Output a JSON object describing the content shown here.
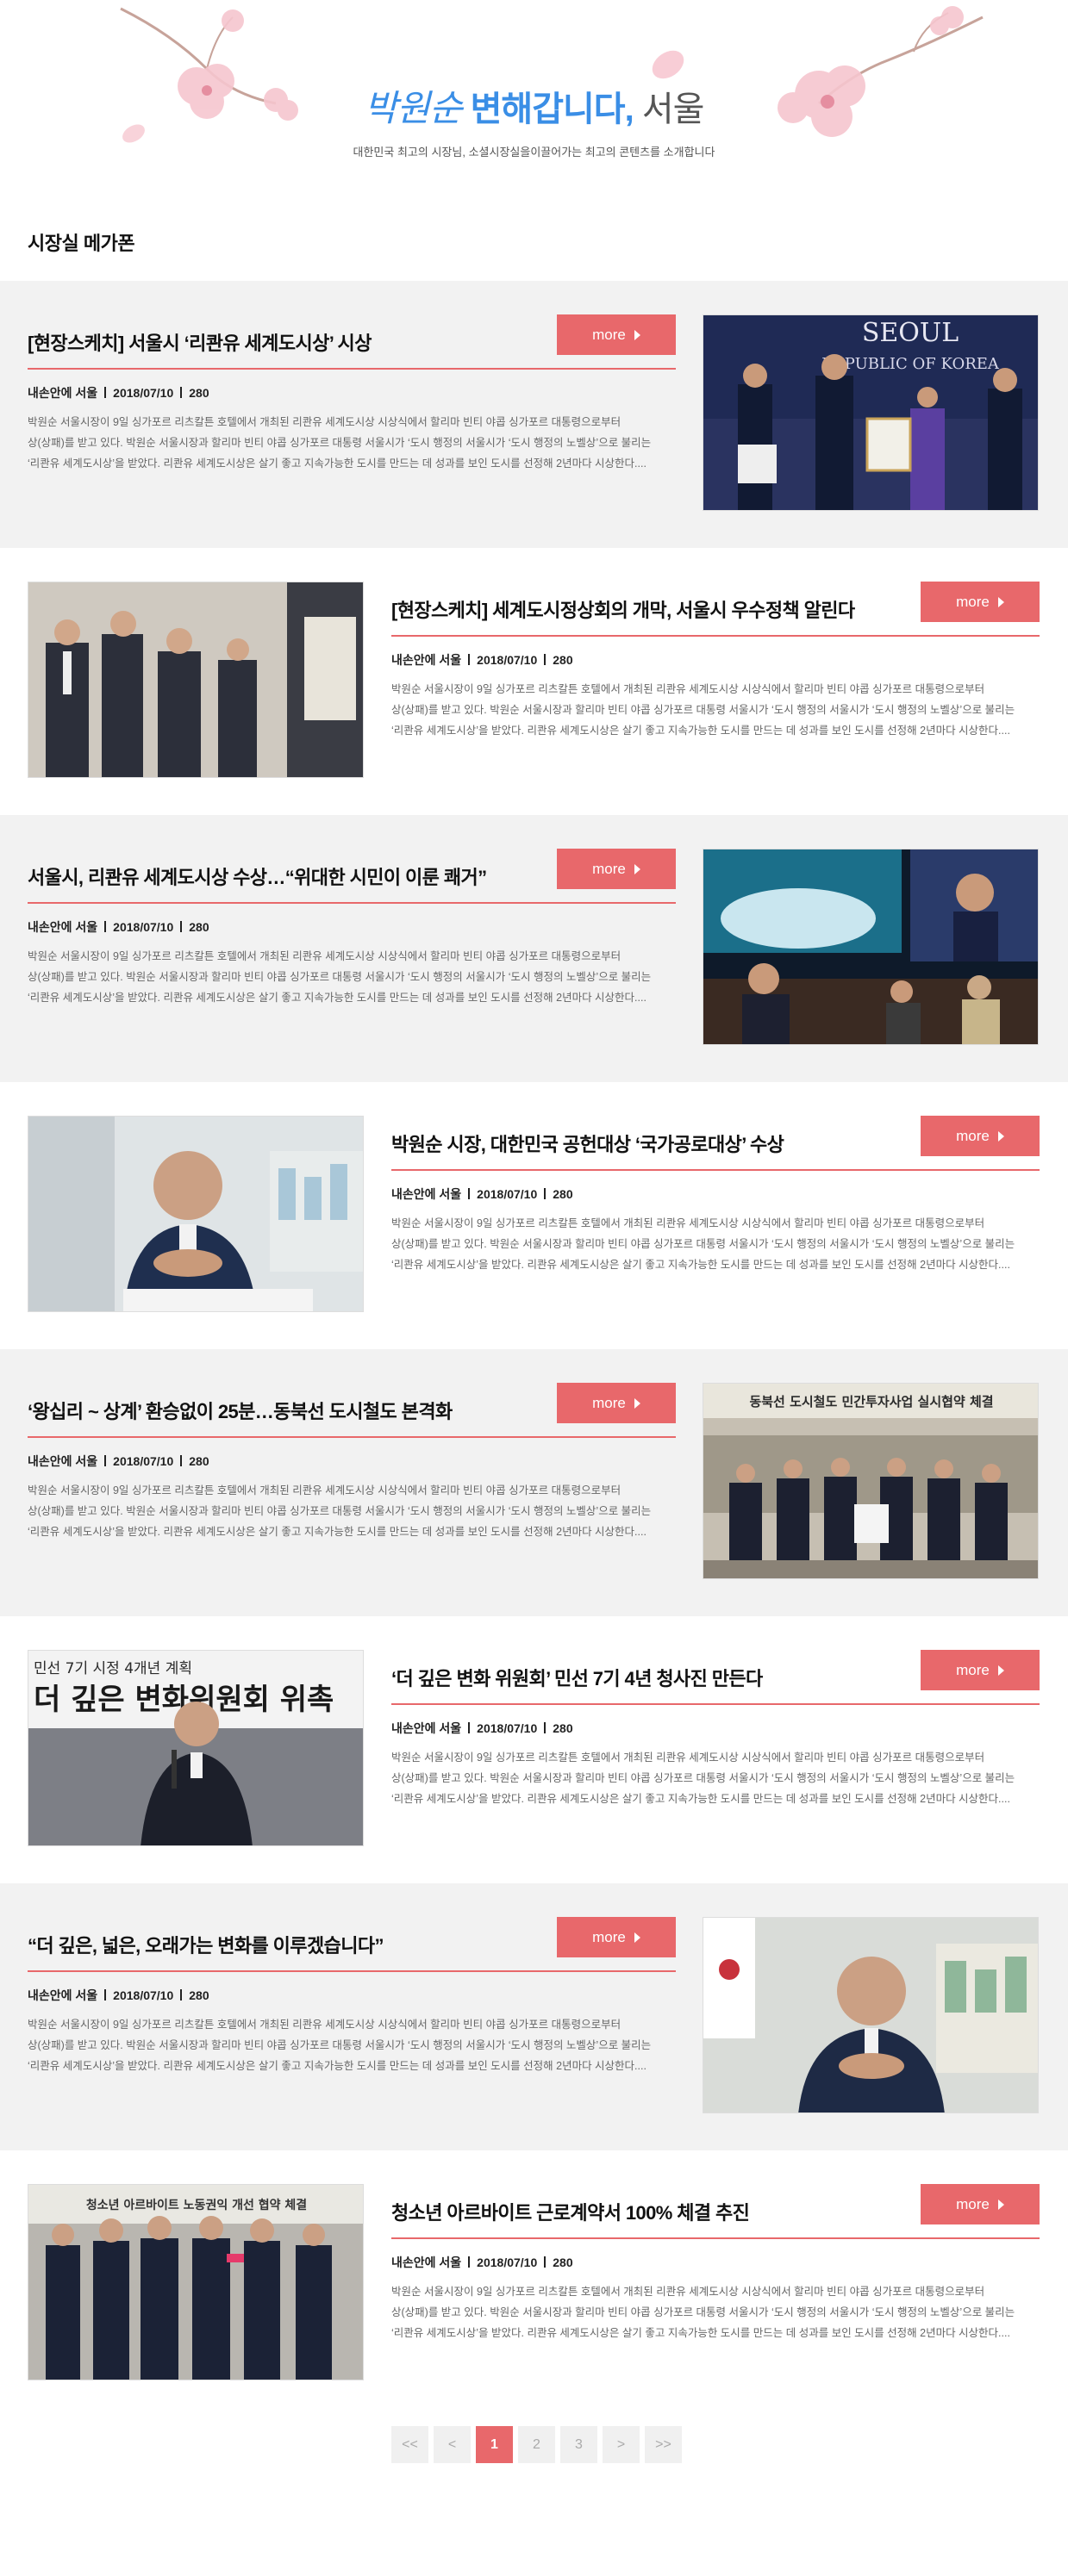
{
  "hero": {
    "title_name": "박원순",
    "title_main": "변해갑니다,",
    "title_city": "서울",
    "subtitle": "대한민국 최고의 시장님, 소셜시장실을이끌어가는 최고의 콘텐츠를 소개합니다"
  },
  "section": {
    "title": "시장실 메가폰"
  },
  "colors": {
    "accent": "#e8686b",
    "title_blue": "#3a8ee6",
    "row_gray": "#f2f2f2"
  },
  "articles": [
    {
      "title": "[현장스케치] 서울시 ‘리콴유 세계도시상’ 시상",
      "author": "내손안에 서울",
      "date": "2018/07/10",
      "views": "280",
      "more": "more",
      "body1": "박원순 서울시장이 9일 싱가포르 리츠칼튼 호텔에서 개최된 리콴유 세계도시상 시상식에서 할리마 빈티 야콥 싱가포르 대통령으로부터",
      "body2": "상(상패)를 받고 있다. 박원순 서울시장과 할리마 빈티 야콥 싱가포르 대통령 서울시가 ‘도시 행정의 서울시가 ‘도시 행정의 노벨상’으로 불리는",
      "body3": "‘리콴유 세계도시상’을 받았다. 리콴유 세계도시상은 살기 좋고 지속가능한 도시를 만드는 데 성과를 보인 도시를 선정해 2년마다 시상한다....",
      "image": "award-ceremony-photo",
      "photo_text": "SEOUL",
      "photo_text2": "REPUBLIC OF KOREA"
    },
    {
      "title": "[현장스케치] 세계도시정상회의 개막, 서울시 우수정책 알린다",
      "author": "내손안에 서울",
      "date": "2018/07/10",
      "views": "280",
      "more": "more",
      "body1": "박원순 서울시장이 9일 싱가포르 리츠칼튼 호텔에서 개최된 리콴유 세계도시상 시상식에서 할리마 빈티 야콥 싱가포르 대통령으로부터",
      "body2": "상(상패)를 받고 있다. 박원순 서울시장과 할리마 빈티 야콥 싱가포르 대통령 서울시가 ‘도시 행정의 서울시가 ‘도시 행정의 노벨상’으로 불리는",
      "body3": "‘리콴유 세계도시상’을 받았다. 리콴유 세계도시상은 살기 좋고 지속가능한 도시를 만드는 데 성과를 보인 도시를 선정해 2년마다 시상한다....",
      "image": "exhibition-visit-photo"
    },
    {
      "title": "서울시, 리콴유 세계도시상 수상…“위대한 시민이 이룬 쾌거”",
      "author": "내손안에 서울",
      "date": "2018/07/10",
      "views": "280",
      "more": "more",
      "body1": "박원순 서울시장이 9일 싱가포르 리츠칼튼 호텔에서 개최된 리콴유 세계도시상 시상식에서 할리마 빈티 야콥 싱가포르 대통령으로부터",
      "body2": "상(상패)를 받고 있다. 박원순 서울시장과 할리마 빈티 야콥 싱가포르 대통령 서울시가 ‘도시 행정의 서울시가 ‘도시 행정의 노벨상’으로 불리는",
      "body3": "‘리콴유 세계도시상’을 받았다. 리콴유 세계도시상은 살기 좋고 지속가능한 도시를 만드는 데 성과를 보인 도시를 선정해 2년마다 시상한다....",
      "image": "ceremony-screen-photo"
    },
    {
      "title": "박원순 시장, 대한민국 공헌대상 ‘국가공로대상’ 수상",
      "author": "내손안에 서울",
      "date": "2018/07/10",
      "views": "280",
      "more": "more",
      "body1": "박원순 서울시장이 9일 싱가포르 리츠칼튼 호텔에서 개최된 리콴유 세계도시상 시상식에서 할리마 빈티 야콥 싱가포르 대통령으로부터",
      "body2": "상(상패)를 받고 있다. 박원순 서울시장과 할리마 빈티 야콥 싱가포르 대통령 서울시가 ‘도시 행정의 서울시가 ‘도시 행정의 노벨상’으로 불리는",
      "body3": "‘리콴유 세계도시상’을 받았다. 리콴유 세계도시상은 살기 좋고 지속가능한 도시를 만드는 데 성과를 보인 도시를 선정해 2년마다 시상한다....",
      "image": "mayor-office-portrait"
    },
    {
      "title": "‘왕십리 ~ 상계’ 환승없이 25분…동북선 도시철도 본격화",
      "author": "내손안에 서울",
      "date": "2018/07/10",
      "views": "280",
      "more": "more",
      "body1": "박원순 서울시장이 9일 싱가포르 리츠칼튼 호텔에서 개최된 리콴유 세계도시상 시상식에서 할리마 빈티 야콥 싱가포르 대통령으로부터",
      "body2": "상(상패)를 받고 있다. 박원순 서울시장과 할리마 빈티 야콥 싱가포르 대통령 서울시가 ‘도시 행정의 서울시가 ‘도시 행정의 노벨상’으로 불리는",
      "body3": "‘리콴유 세계도시상’을 받았다. 리콴유 세계도시상은 살기 좋고 지속가능한 도시를 만드는 데 성과를 보인 도시를 선정해 2년마다 시상한다....",
      "image": "agreement-signing-photo",
      "photo_text": "동북선 도시철도 민간투자사업 실시협약 체결"
    },
    {
      "title": "‘더 깊은 변화 위원회’ 민선 7기 4년 청사진 만든다",
      "author": "내손안에 서울",
      "date": "2018/07/10",
      "views": "280",
      "more": "more",
      "body1": "박원순 서울시장이 9일 싱가포르 리츠칼튼 호텔에서 개최된 리콴유 세계도시상 시상식에서 할리마 빈티 야콥 싱가포르 대통령으로부터",
      "body2": "상(상패)를 받고 있다. 박원순 서울시장과 할리마 빈티 야콥 싱가포르 대통령 서울시가 ‘도시 행정의 서울시가 ‘도시 행정의 노벨상’으로 불리는",
      "body3": "‘리콴유 세계도시상’을 받았다. 리콴유 세계도시상은 살기 좋고 지속가능한 도시를 만드는 데 성과를 보인 도시를 선정해 2년마다 시상한다....",
      "image": "committee-speech-photo",
      "photo_text": "민선 7기 시정 4개년 계획",
      "photo_text2": "더 깊은 변화위원회 위촉"
    },
    {
      "title": "“더 깊은, 넓은, 오래가는 변화를 이루겠습니다”",
      "author": "내손안에 서울",
      "date": "2018/07/10",
      "views": "280",
      "more": "more",
      "body1": "박원순 서울시장이 9일 싱가포르 리츠칼튼 호텔에서 개최된 리콴유 세계도시상 시상식에서 할리마 빈티 야콥 싱가포르 대통령으로부터",
      "body2": "상(상패)를 받고 있다. 박원순 서울시장과 할리마 빈티 야콥 싱가포르 대통령 서울시가 ‘도시 행정의 서울시가 ‘도시 행정의 노벨상’으로 불리는",
      "body3": "‘리콴유 세계도시상’을 받았다. 리콴유 세계도시상은 살기 좋고 지속가능한 도시를 만드는 데 성과를 보인 도시를 선정해 2년마다 시상한다....",
      "image": "mayor-desk-portrait"
    },
    {
      "title": "청소년 아르바이트 근로계약서 100% 체결 추진",
      "author": "내손안에 서울",
      "date": "2018/07/10",
      "views": "280",
      "more": "more",
      "body1": "박원순 서울시장이 9일 싱가포르 리츠칼튼 호텔에서 개최된 리콴유 세계도시상 시상식에서 할리마 빈티 야콥 싱가포르 대통령으로부터",
      "body2": "상(상패)를 받고 있다. 박원순 서울시장과 할리마 빈티 야콥 싱가포르 대통령 서울시가 ‘도시 행정의 서울시가 ‘도시 행정의 노벨상’으로 불리는",
      "body3": "‘리콴유 세계도시상’을 받았다. 리콴유 세계도시상은 살기 좋고 지속가능한 도시를 만드는 데 성과를 보인 도시를 선정해 2년마다 시상한다....",
      "image": "group-photo",
      "photo_text": "청소년 아르바이트 노동권익 개선 협약 체결"
    }
  ],
  "pagination": {
    "first": "<<",
    "prev": "<",
    "pages": [
      "1",
      "2",
      "3"
    ],
    "current": "1",
    "next": ">",
    "last": ">>"
  }
}
